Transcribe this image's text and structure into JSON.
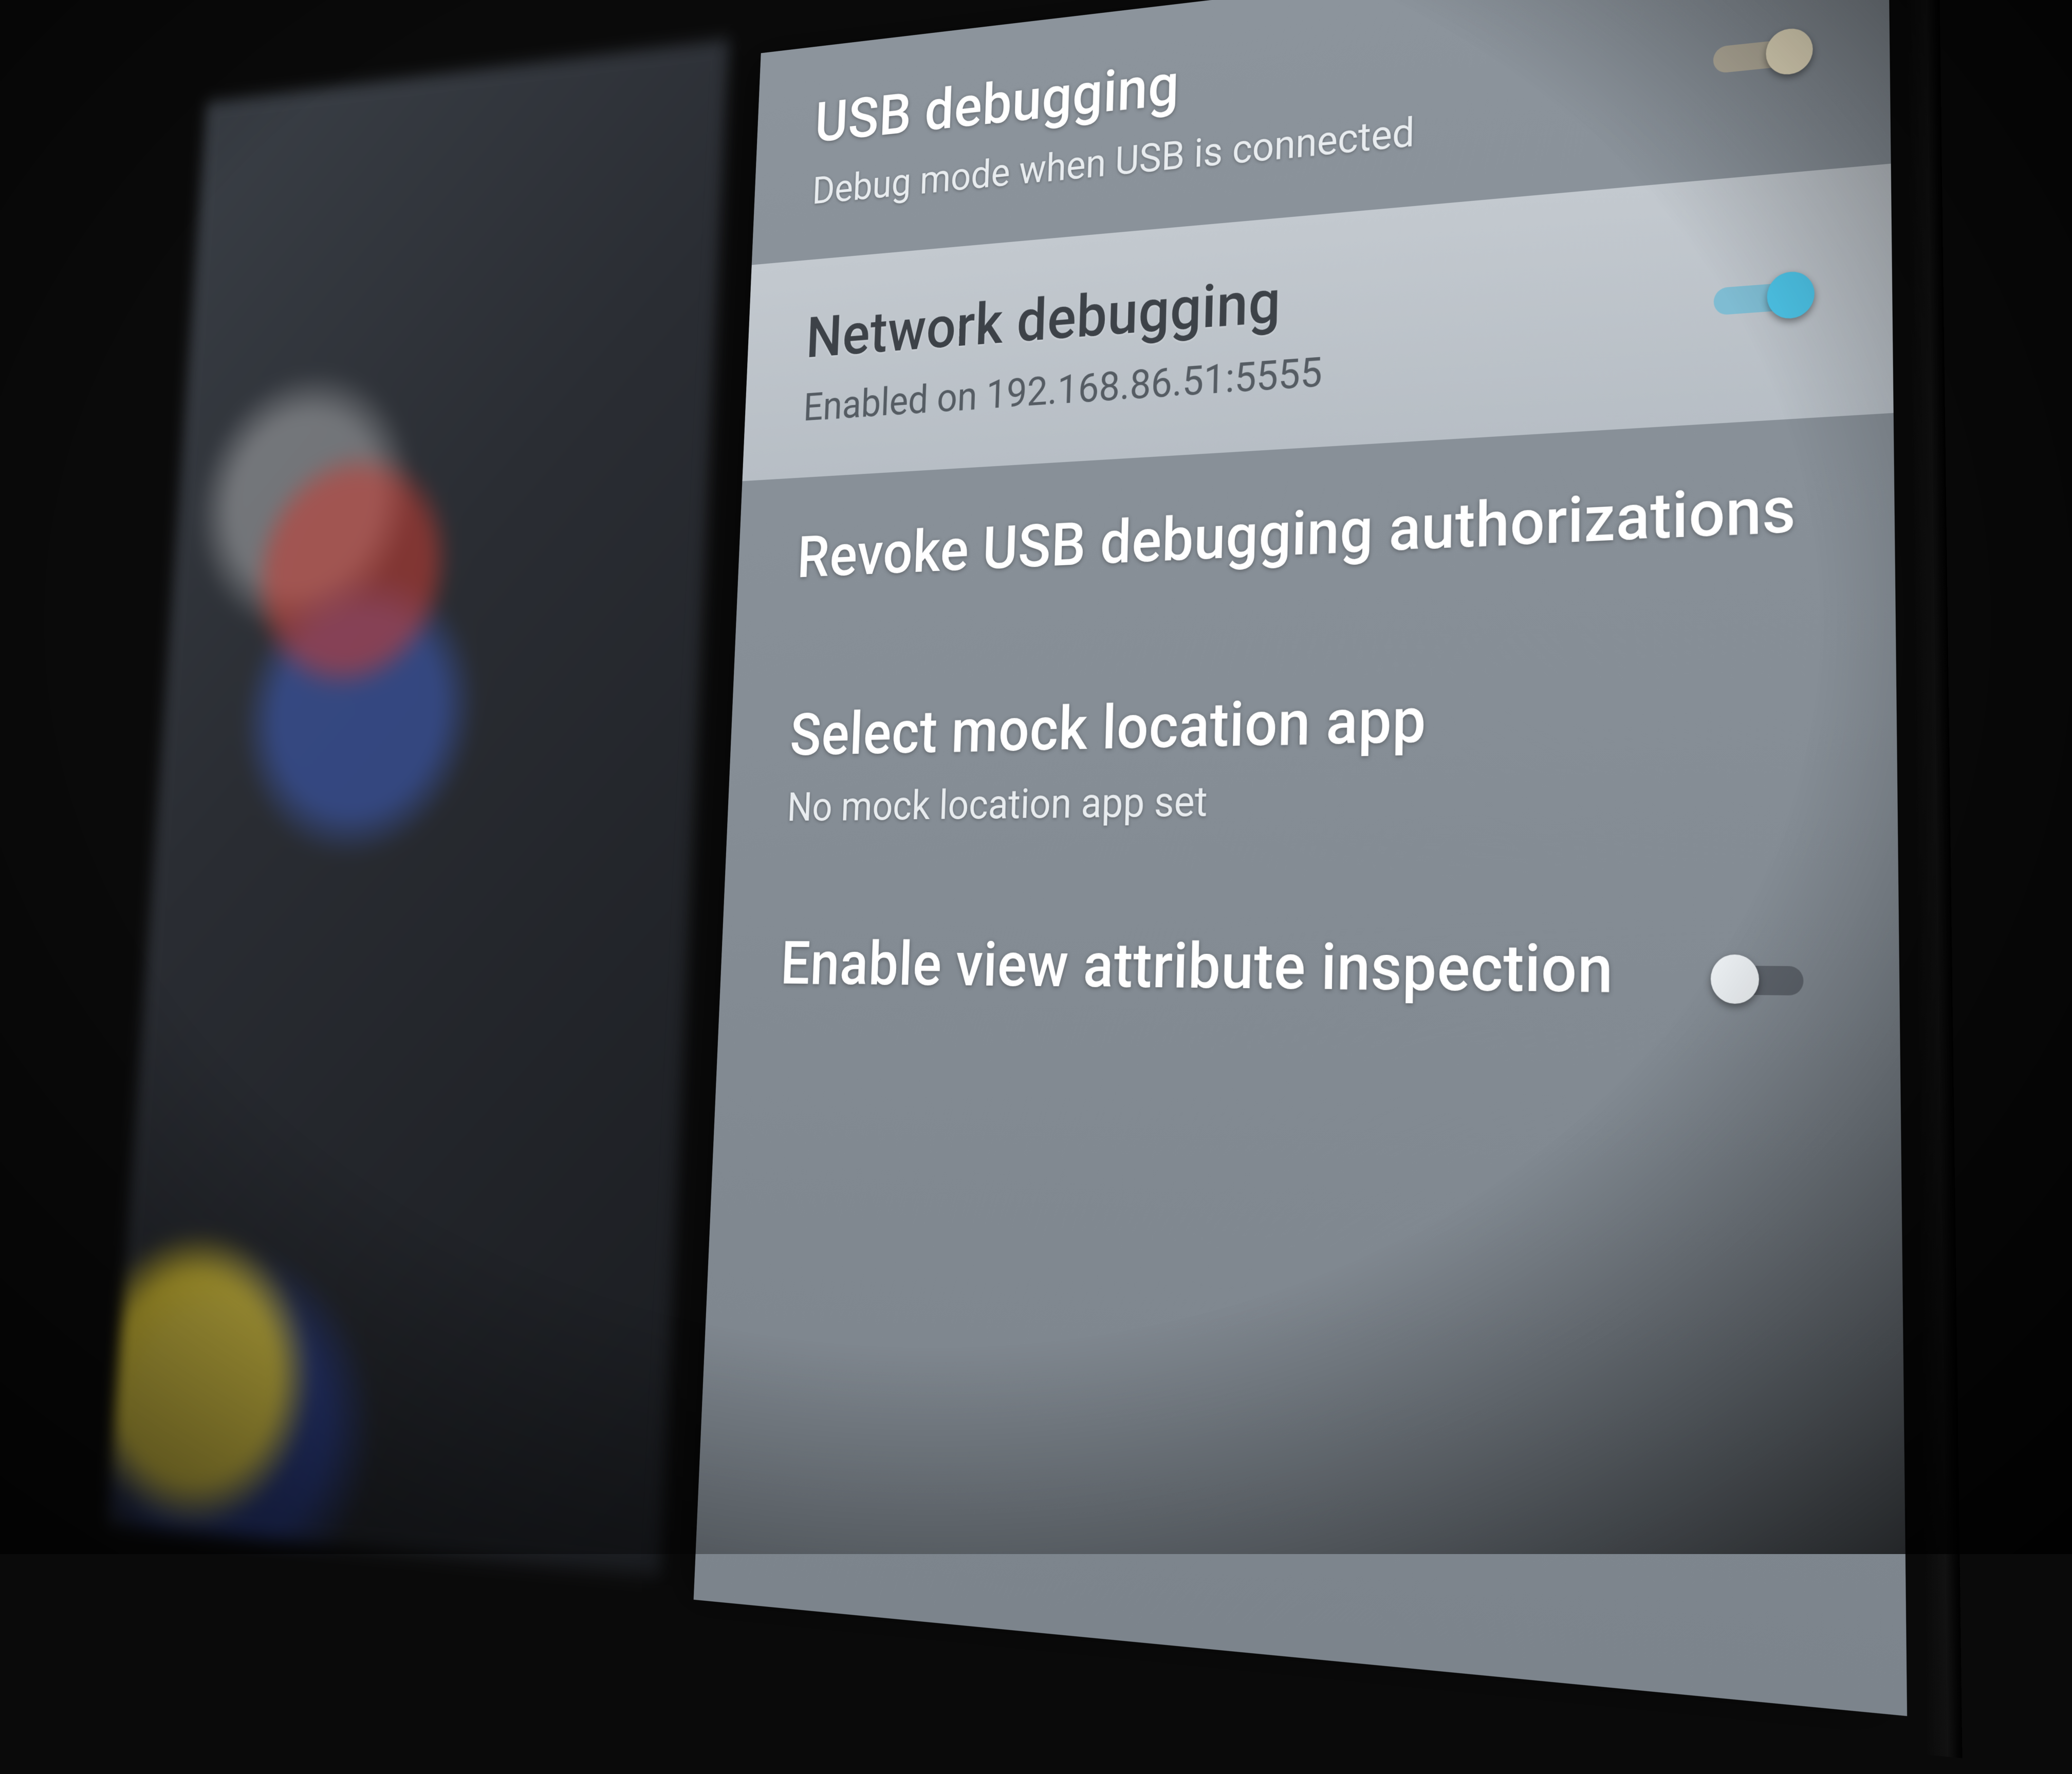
{
  "settings": {
    "items": [
      {
        "title": "USB debugging",
        "subtitle": "Debug mode when USB is connected",
        "toggle": "on"
      },
      {
        "title": "Network debugging",
        "subtitle": "Enabled on 192.168.86.51:5555",
        "toggle": "on",
        "selected": true
      },
      {
        "title": "Revoke USB debugging authorizations",
        "subtitle": "",
        "toggle": null
      },
      {
        "title": "Select mock location app",
        "subtitle": "No mock location app set",
        "toggle": null
      },
      {
        "title": "Enable view attribute inspection",
        "subtitle": "",
        "toggle": "off"
      }
    ]
  },
  "colors": {
    "panel_bg": "#868e96",
    "selected_bg": "#bcc3ca",
    "toggle_on": "#4dc3e6",
    "toggle_off_knob": "#e9edf0"
  }
}
